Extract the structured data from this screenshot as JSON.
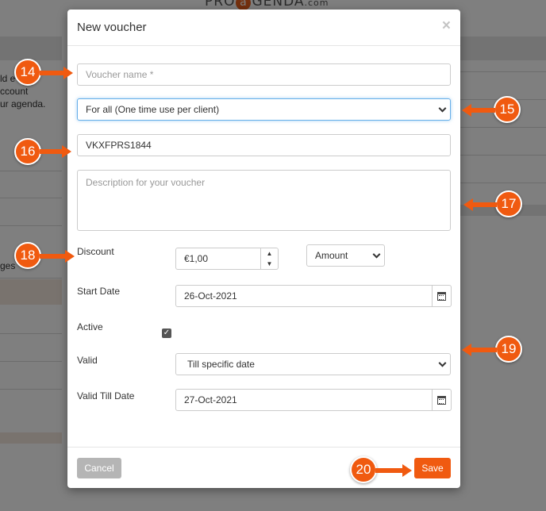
{
  "background": {
    "logo": {
      "pre": "PRO",
      "a": "a",
      "post": "GENDA",
      "com": ".com"
    },
    "text_lines": [
      "ld e",
      "ccount",
      "ur agenda.",
      "ges"
    ]
  },
  "modal": {
    "title": "New voucher",
    "close_glyph": "×",
    "voucher_name": {
      "placeholder": "Voucher name *",
      "value": ""
    },
    "usage_select": {
      "value": "For all (One time use per client)"
    },
    "code": {
      "value": "VKXFPRS1844"
    },
    "description": {
      "placeholder": "Description for your voucher",
      "value": ""
    },
    "discount": {
      "label": "Discount",
      "value": "€1,00",
      "up_glyph": "▲",
      "down_glyph": "▼",
      "type_select": "Amount"
    },
    "start_date": {
      "label": "Start Date",
      "value": "26-Oct-2021"
    },
    "active": {
      "label": "Active",
      "checked": true,
      "check_glyph": "✓"
    },
    "valid": {
      "label": "Valid",
      "value": "Till specific date"
    },
    "valid_till": {
      "label": "Valid Till Date",
      "value": "27-Oct-2021"
    },
    "footer": {
      "cancel_label": "Cancel",
      "save_label": "Save"
    }
  },
  "callouts": [
    "14",
    "15",
    "16",
    "17",
    "18",
    "19",
    "20"
  ],
  "colors": {
    "accent": "#f05a10",
    "focus": "#66afe9",
    "cancel": "#b5b5b5"
  }
}
